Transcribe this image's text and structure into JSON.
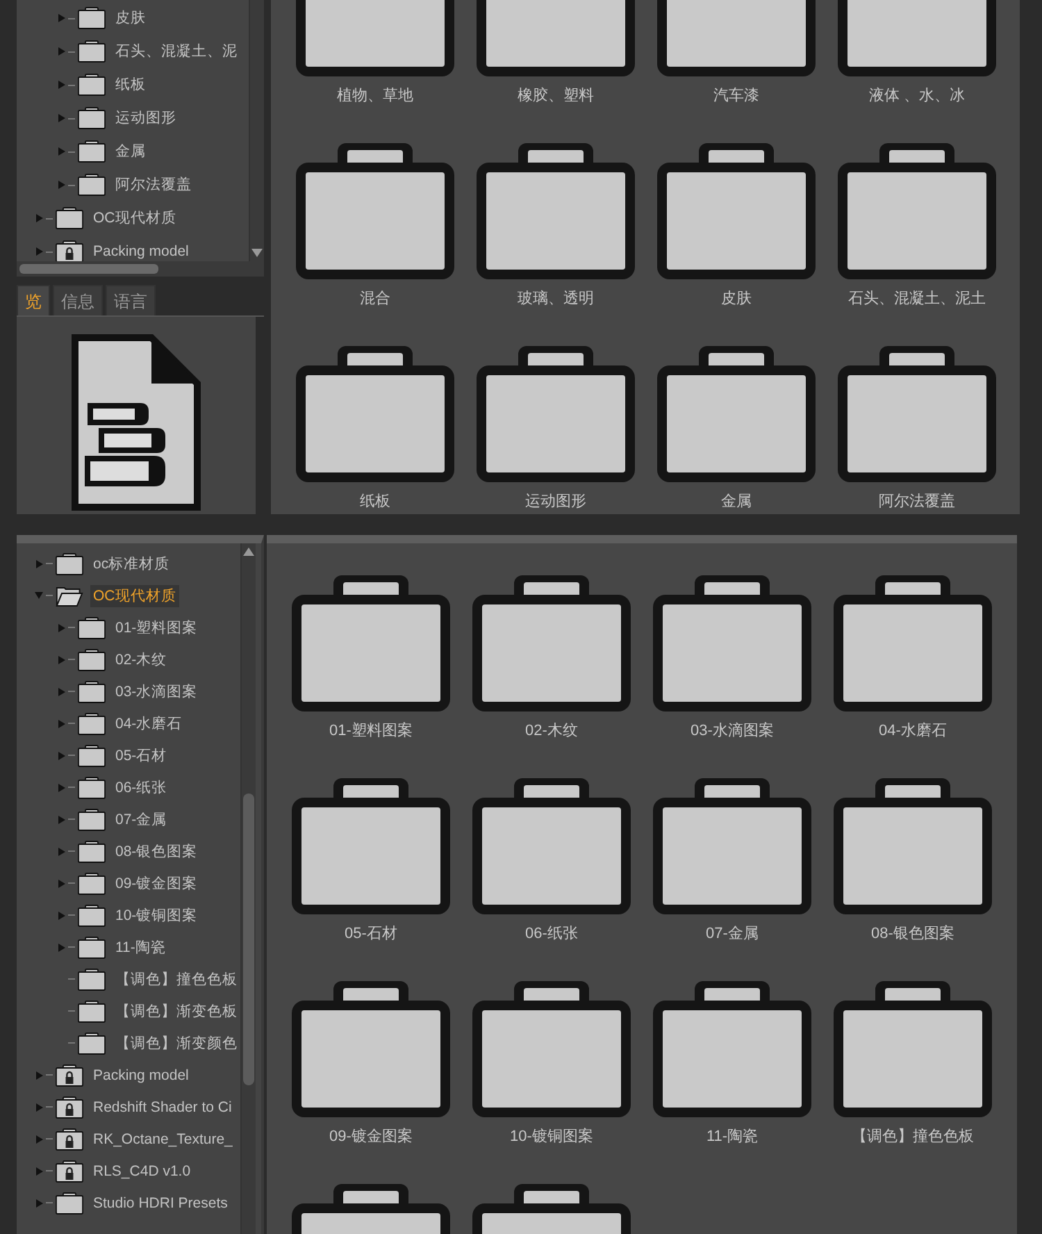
{
  "top_panel": {
    "tree": {
      "items": [
        {
          "children": [
            {
              "label": "皮肤",
              "kind": "folder",
              "expandable": true,
              "expanded": false,
              "selected": false
            },
            {
              "label": "石头、混凝土、泥",
              "kind": "folder",
              "expandable": true,
              "expanded": false,
              "selected": false
            },
            {
              "label": "纸板",
              "kind": "folder",
              "expandable": true,
              "expanded": false,
              "selected": false
            },
            {
              "label": "运动图形",
              "kind": "folder",
              "expandable": true,
              "expanded": false,
              "selected": false
            },
            {
              "label": "金属",
              "kind": "folder",
              "expandable": true,
              "expanded": false,
              "selected": false
            },
            {
              "label": "阿尔法覆盖",
              "kind": "folder",
              "expandable": true,
              "expanded": false,
              "selected": false
            }
          ]
        },
        {
          "label": "OC现代材质",
          "kind": "folder",
          "expandable": true,
          "expanded": false,
          "selected": false
        },
        {
          "label": "Packing model",
          "kind": "locked",
          "expandable": true,
          "expanded": false,
          "selected": false
        }
      ]
    },
    "tabs": [
      {
        "label": "览",
        "selected": true
      },
      {
        "label": "信息",
        "selected": false
      },
      {
        "label": "语言",
        "selected": false
      }
    ],
    "grid": [
      {
        "kind": "folder",
        "label": "植物、草地"
      },
      {
        "kind": "folder",
        "label": "橡胶、塑料"
      },
      {
        "kind": "folder",
        "label": "汽车漆"
      },
      {
        "kind": "folder",
        "label": "液体 、水、冰"
      },
      {
        "kind": "folder",
        "label": "混合"
      },
      {
        "kind": "folder",
        "label": "玻璃、透明"
      },
      {
        "kind": "folder",
        "label": "皮肤"
      },
      {
        "kind": "folder",
        "label": "石头、混凝土、泥土"
      },
      {
        "kind": "folder",
        "label": "纸板"
      },
      {
        "kind": "folder",
        "label": "运动图形"
      },
      {
        "kind": "folder",
        "label": "金属"
      },
      {
        "kind": "folder",
        "label": "阿尔法覆盖"
      }
    ]
  },
  "bottom_panel": {
    "tree": {
      "items": [
        {
          "label": "oc标准材质",
          "kind": "folder",
          "expandable": true,
          "expanded": false,
          "selected": false
        },
        {
          "label": "OC现代材质",
          "kind": "folder",
          "expandable": true,
          "expanded": true,
          "selected": true,
          "children": [
            {
              "label": "01-塑料图案",
              "kind": "folder",
              "expandable": true,
              "expanded": false,
              "selected": false
            },
            {
              "label": "02-木纹",
              "kind": "folder",
              "expandable": true,
              "expanded": false,
              "selected": false
            },
            {
              "label": "03-水滴图案",
              "kind": "folder",
              "expandable": true,
              "expanded": false,
              "selected": false
            },
            {
              "label": "04-水磨石",
              "kind": "folder",
              "expandable": true,
              "expanded": false,
              "selected": false
            },
            {
              "label": "05-石材",
              "kind": "folder",
              "expandable": true,
              "expanded": false,
              "selected": false
            },
            {
              "label": "06-纸张",
              "kind": "folder",
              "expandable": true,
              "expanded": false,
              "selected": false
            },
            {
              "label": "07-金属",
              "kind": "folder",
              "expandable": true,
              "expanded": false,
              "selected": false
            },
            {
              "label": "08-银色图案",
              "kind": "folder",
              "expandable": true,
              "expanded": false,
              "selected": false
            },
            {
              "label": "09-镀金图案",
              "kind": "folder",
              "expandable": true,
              "expanded": false,
              "selected": false
            },
            {
              "label": "10-镀铜图案",
              "kind": "folder",
              "expandable": true,
              "expanded": false,
              "selected": false
            },
            {
              "label": "11-陶瓷",
              "kind": "folder",
              "expandable": true,
              "expanded": false,
              "selected": false
            },
            {
              "label": "【调色】撞色色板",
              "kind": "folder",
              "expandable": false,
              "expanded": false,
              "selected": false
            },
            {
              "label": "【调色】渐变色板",
              "kind": "folder",
              "expandable": false,
              "expanded": false,
              "selected": false
            },
            {
              "label": "【调色】渐变颜色",
              "kind": "folder",
              "expandable": false,
              "expanded": false,
              "selected": false
            }
          ]
        },
        {
          "label": "Packing model",
          "kind": "locked",
          "expandable": true,
          "expanded": false,
          "selected": false
        },
        {
          "label": "Redshift Shader to Ci",
          "kind": "locked",
          "expandable": true,
          "expanded": false,
          "selected": false
        },
        {
          "label": "RK_Octane_Texture_",
          "kind": "locked",
          "expandable": true,
          "expanded": false,
          "selected": false
        },
        {
          "label": "RLS_C4D v1.0",
          "kind": "locked",
          "expandable": true,
          "expanded": false,
          "selected": false
        },
        {
          "label": "Studio HDRI Presets",
          "kind": "folder",
          "expandable": true,
          "expanded": false,
          "selected": false
        }
      ]
    },
    "grid": [
      {
        "kind": "folder",
        "label": "01-塑料图案"
      },
      {
        "kind": "folder",
        "label": "02-木纹"
      },
      {
        "kind": "folder",
        "label": "03-水滴图案"
      },
      {
        "kind": "folder",
        "label": "04-水磨石"
      },
      {
        "kind": "folder",
        "label": "05-石材"
      },
      {
        "kind": "folder",
        "label": "06-纸张"
      },
      {
        "kind": "folder",
        "label": "07-金属"
      },
      {
        "kind": "folder",
        "label": "08-银色图案"
      },
      {
        "kind": "folder",
        "label": "09-镀金图案"
      },
      {
        "kind": "folder",
        "label": "10-镀铜图案"
      },
      {
        "kind": "folder",
        "label": "11-陶瓷"
      },
      {
        "kind": "folder",
        "label": "【调色】撞色色板"
      },
      {
        "kind": "folder"
      },
      {
        "kind": "folder"
      }
    ]
  }
}
